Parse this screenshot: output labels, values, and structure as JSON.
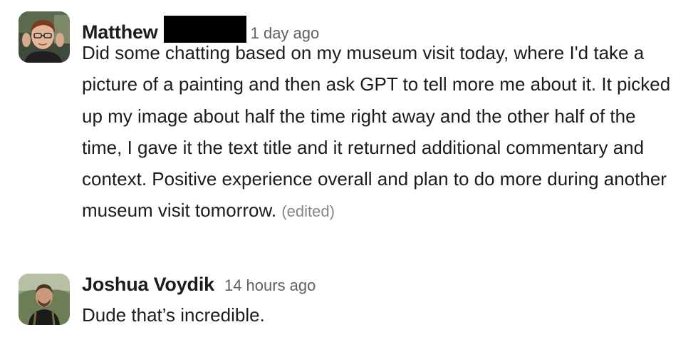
{
  "messages": [
    {
      "sender": "Matthew",
      "timestamp": "1 day ago",
      "text": "Did some chatting based on my museum visit today, where I'd take a picture of a painting and then ask GPT to tell more me about it. It picked up my image about half the time right away and the other half of the time, I gave it the text title and it returned additional commentary and context. Positive experience overall and plan to do more during another museum visit tomorrow.",
      "edited_label": "(edited)",
      "avatar_icon": "user-avatar-photo"
    },
    {
      "sender": "Joshua Voydik",
      "timestamp": "14 hours ago",
      "text": "Dude that’s incredible.",
      "avatar_icon": "user-avatar-photo"
    }
  ],
  "colors": {
    "text": "#1d1c1d",
    "timestamp": "#616061",
    "edited": "#868686",
    "redaction": "#000000"
  }
}
